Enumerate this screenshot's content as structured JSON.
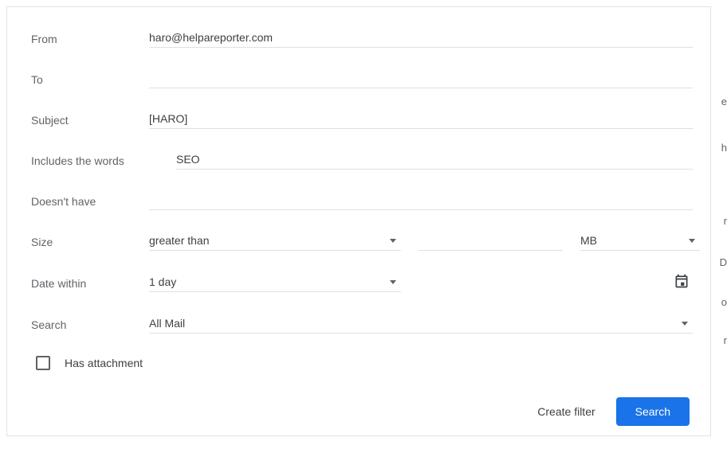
{
  "labels": {
    "from": "From",
    "to": "To",
    "subject": "Subject",
    "includes": "Includes the words",
    "doesnt": "Doesn't have",
    "size": "Size",
    "date": "Date within",
    "search": "Search",
    "attachment": "Has attachment"
  },
  "fields": {
    "from": "haro@helpareporter.com",
    "to": "",
    "subject": "[HARO]",
    "includes": "SEO",
    "doesnt": "",
    "size_comparator": "greater than",
    "size_value": "",
    "size_unit": "MB",
    "date_within": "1 day",
    "search_in": "All Mail",
    "has_attachment": false
  },
  "actions": {
    "create_filter": "Create filter",
    "search": "Search"
  },
  "peek": {
    "a": "e",
    "b": "r",
    "c": "D",
    "d": "o",
    "e": "r",
    "f": "h"
  }
}
